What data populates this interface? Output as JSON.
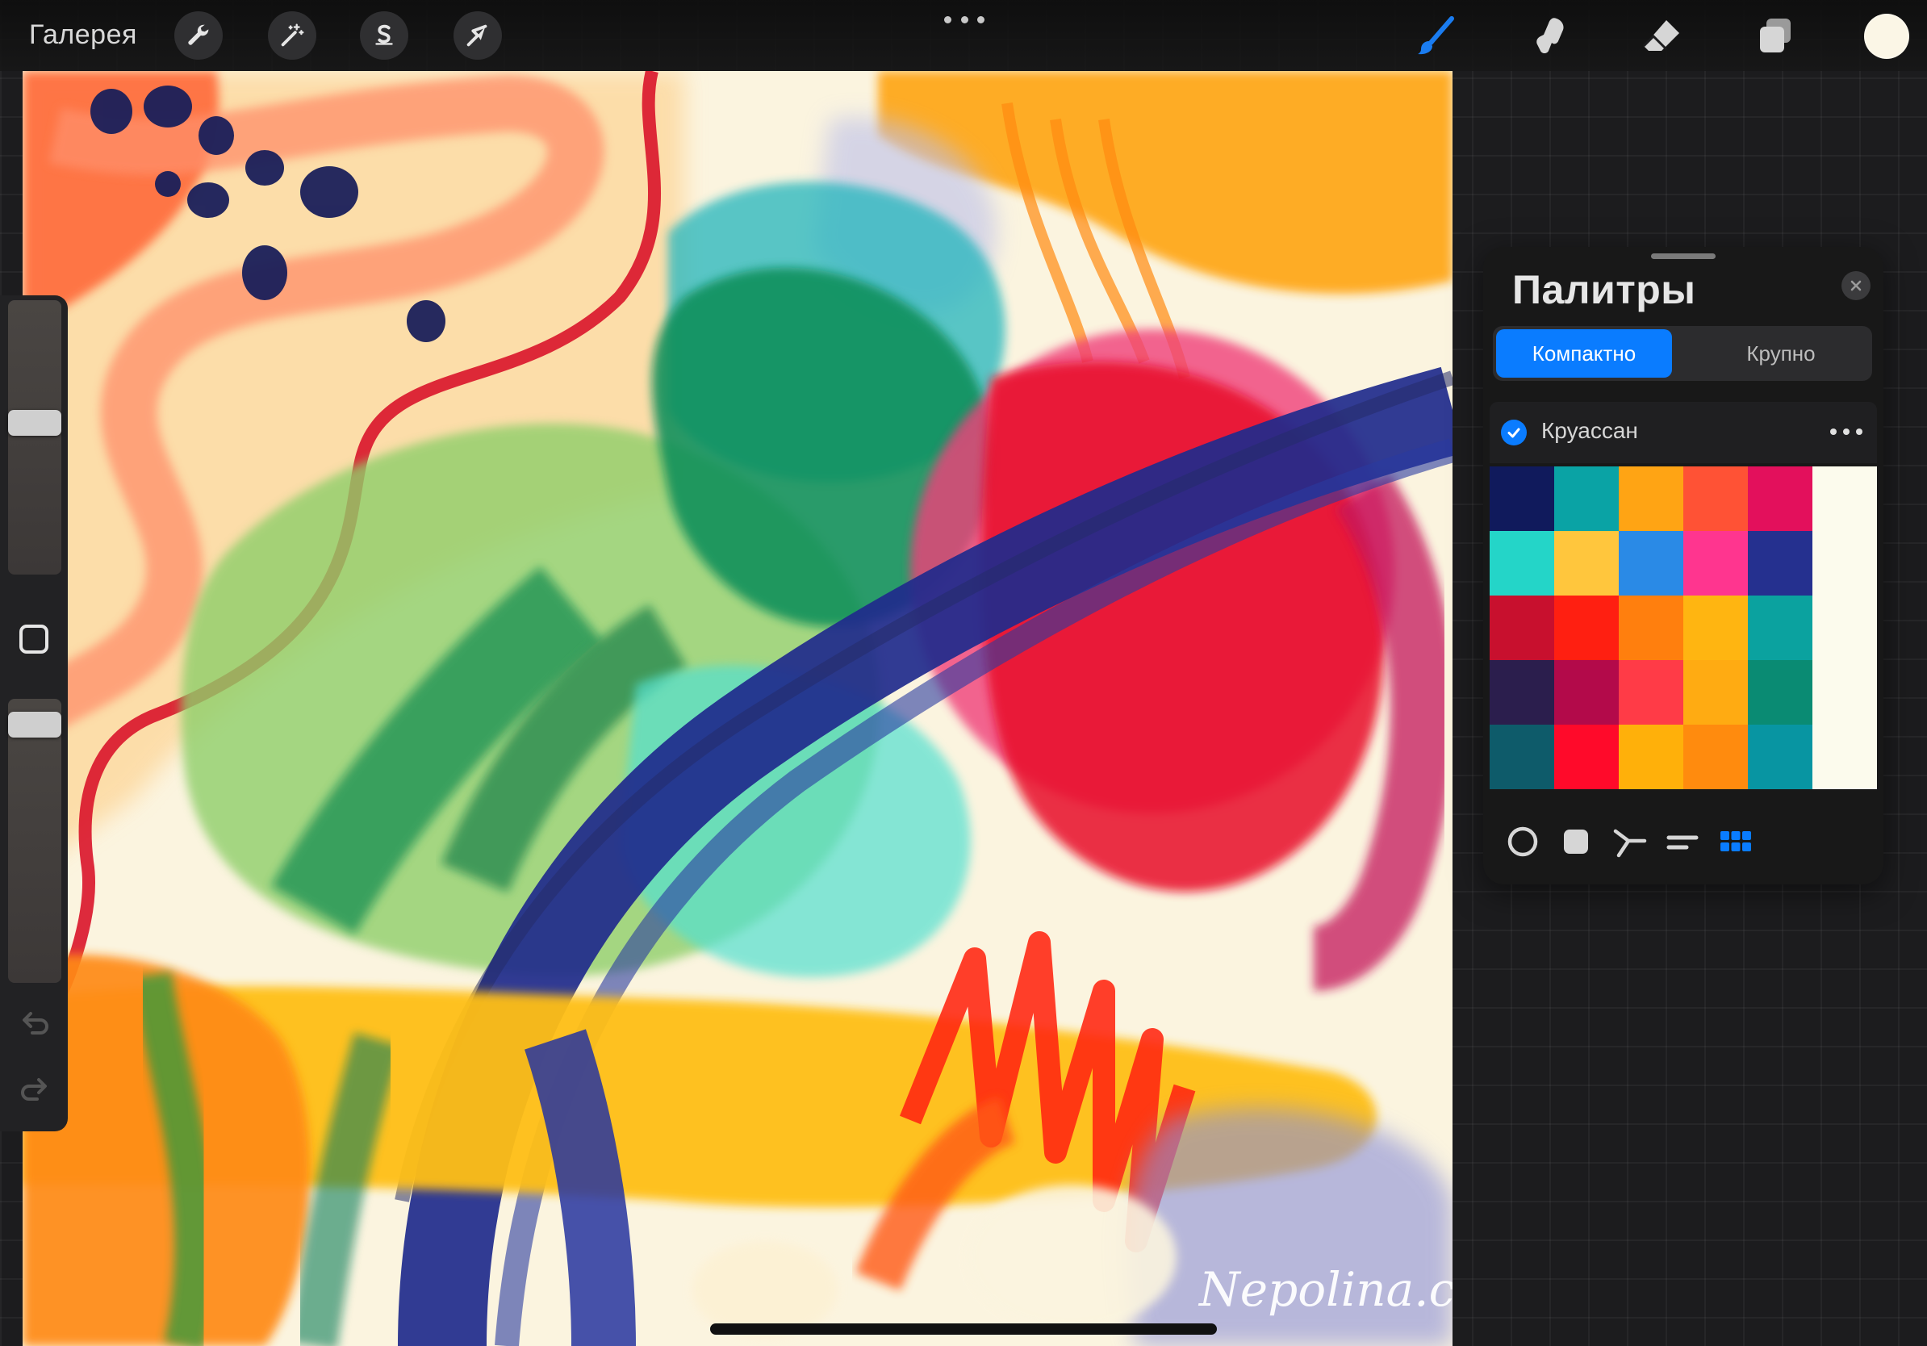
{
  "toolbar": {
    "gallery_label": "Галерея",
    "actions_icon": "wrench-icon",
    "adjustments_icon": "magic-wand-icon",
    "selection_icon": "selection-s-icon",
    "transform_icon": "arrow-cursor-icon",
    "tools": [
      "brush-icon",
      "smudge-icon",
      "eraser-icon",
      "layers-icon"
    ],
    "active_tool_color": "#1a7cf0",
    "current_color": "#fbf6e6"
  },
  "panel": {
    "title": "Палитры",
    "tabs": [
      "Компактно",
      "Крупно"
    ],
    "active_tab": "Компактно",
    "palette_name": "Круассан",
    "palette_checked": true,
    "swatches": [
      "#101a5c",
      "#0aa3a5",
      "#ffa414",
      "#ff5235",
      "#e3105c",
      "#fcfbed",
      "#24d5c8",
      "#ffc63d",
      "#2a8ae6",
      "#ff358f",
      "#25308f",
      "#fcfbed",
      "#c8102e",
      "#ff1f11",
      "#ff7f0e",
      "#ffb511",
      "#0ba29f",
      "#fcfbed",
      "#2b1e4d",
      "#b30a4a",
      "#ff3b47",
      "#ffab12",
      "#0a8b73",
      "#fcfbed",
      "#0e5b6a",
      "#ff0a2a",
      "#ffb00a",
      "#ff8b0e",
      "#0895a2",
      "#fcfbed"
    ],
    "modes": [
      "disc-icon",
      "classic-square-icon",
      "harmony-icon",
      "value-sliders-icon",
      "palettes-grid-icon"
    ],
    "active_mode": "palettes-grid-icon",
    "accent_color": "#0a7cff"
  },
  "canvas": {
    "watermark": "Nepolina.com"
  }
}
